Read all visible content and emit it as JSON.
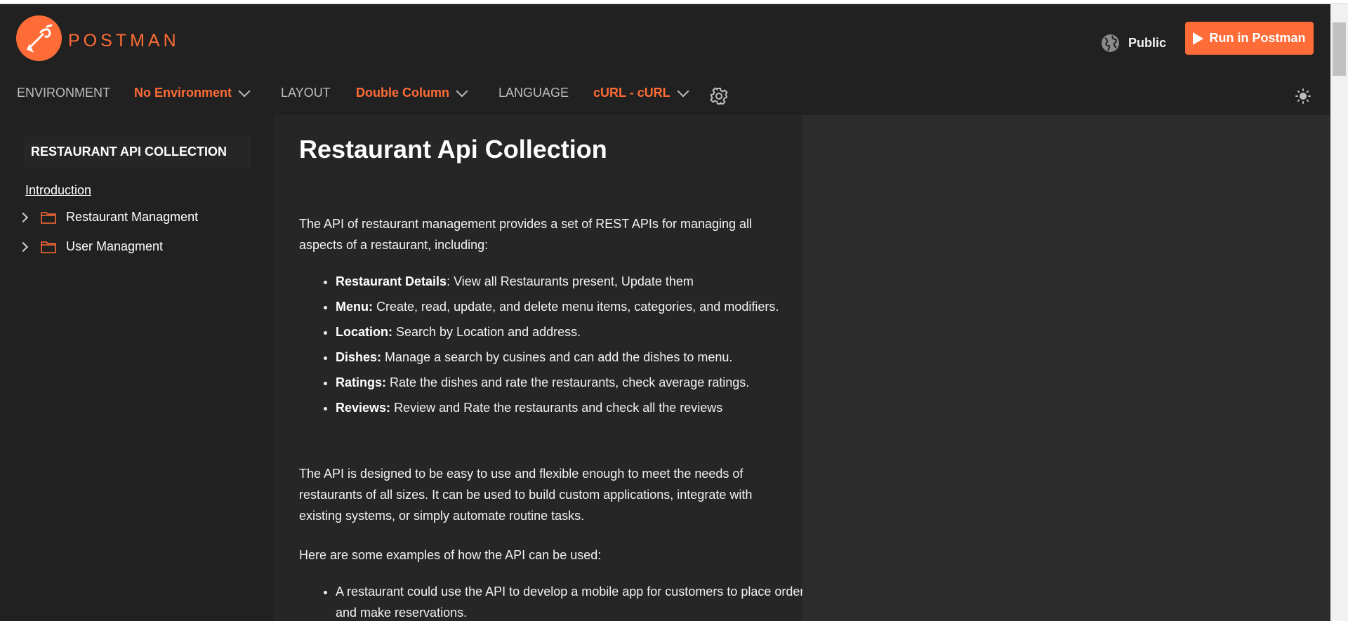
{
  "header": {
    "brand": "POSTMAN",
    "visibility": "Public",
    "run_button": "Run in Postman"
  },
  "toolbar": {
    "environment_label": "ENVIRONMENT",
    "environment_value": "No Environment",
    "layout_label": "LAYOUT",
    "layout_value": "Double Column",
    "language_label": "LANGUAGE",
    "language_value": "cURL - cURL"
  },
  "sidebar": {
    "collection_title": "RESTAURANT API COLLECTION",
    "intro": "Introduction",
    "folders": [
      "Restaurant Managment",
      "User Managment"
    ]
  },
  "doc": {
    "title": "Restaurant Api Collection",
    "intro": "The API of restaurant management provides a set of REST APIs for managing all aspects of a restaurant, including:",
    "features": [
      {
        "term": "Restaurant Details",
        "sep": ": ",
        "desc": "View all Restaurants present, Update them"
      },
      {
        "term": "Menu:",
        "sep": " ",
        "desc": "Create, read, update, and delete menu items, categories, and modifiers."
      },
      {
        "term": "Location:",
        "sep": " ",
        "desc": "Search by Location and address."
      },
      {
        "term": "Dishes:",
        "sep": " ",
        "desc": "Manage a search by cusines and can add the dishes to menu."
      },
      {
        "term": "Ratings:",
        "sep": " ",
        "desc": "Rate the dishes and rate the restaurants, check average ratings."
      },
      {
        "term": "Reviews:",
        "sep": " ",
        "desc": "Review and Rate the restaurants and check all the reviews"
      }
    ],
    "para2": "The API is designed to be easy to use and flexible enough to meet the needs of restaurants of all sizes. It can be used to build custom applications, integrate with existing systems, or simply automate routine tasks.",
    "para3": "Here are some examples of how the API can be used:",
    "examples": [
      "A restaurant could use the API to develop a mobile app for customers to place orders and make reservations."
    ]
  },
  "colors": {
    "accent": "#ff6c37",
    "background": "#212121",
    "doc_background": "#262626",
    "right_background": "#2c2c2c"
  },
  "icons": [
    "postman-logo-icon",
    "globe-icon",
    "play-icon",
    "chevron-down-icon",
    "gear-icon",
    "sun-icon",
    "chevron-right-icon",
    "folder-icon"
  ]
}
